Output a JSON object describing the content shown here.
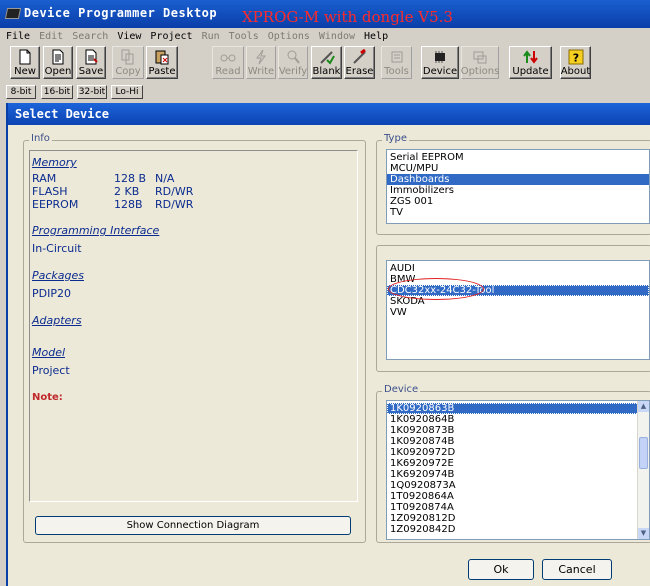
{
  "window": {
    "title": "Device Programmer Desktop"
  },
  "overlay_caption": "XPROG-M with dongle V5.3",
  "menu": [
    {
      "label": "File",
      "enabled": true
    },
    {
      "label": "Edit",
      "enabled": false
    },
    {
      "label": "Search",
      "enabled": false
    },
    {
      "label": "View",
      "enabled": true
    },
    {
      "label": "Project",
      "enabled": true
    },
    {
      "label": "Run",
      "enabled": false
    },
    {
      "label": "Tools",
      "enabled": false
    },
    {
      "label": "Options",
      "enabled": false
    },
    {
      "label": "Window",
      "enabled": false
    },
    {
      "label": "Help",
      "enabled": true
    }
  ],
  "toolbar": {
    "new": "New",
    "open": "Open",
    "save": "Save",
    "copy": "Copy",
    "paste": "Paste",
    "read": "Read",
    "write": "Write",
    "verify": "Verify",
    "blank": "Blank",
    "erase": "Erase",
    "tools": "Tools",
    "device": "Device",
    "options": "Options",
    "update": "Update",
    "about": "About"
  },
  "modes": [
    "8-bit",
    "16-bit",
    "32-bit",
    "Lo-Hi"
  ],
  "dialog": {
    "title": "Select Device",
    "info": {
      "group_label": "Info",
      "memory_heading": "Memory",
      "memory": [
        {
          "name": "RAM",
          "size": "128 B",
          "access": "N/A"
        },
        {
          "name": "FLASH",
          "size": "2 KB",
          "access": "RD/WR"
        },
        {
          "name": "EEPROM",
          "size": "128B",
          "access": "RD/WR"
        }
      ],
      "programming_interface_heading": "Programming Interface",
      "programming_interface": "In-Circuit",
      "packages_heading": "Packages",
      "packages": "PDIP20",
      "adapters_heading": "Adapters",
      "model_heading": "Model",
      "model": "Project",
      "note_label": "Note:"
    },
    "show_diagram_button": "Show Connection Diagram",
    "type": {
      "group_label": "Type",
      "items": [
        "Serial EEPROM",
        "MCU/MPU",
        "Dashboards",
        "Immobilizers",
        "ZGS 001",
        "TV"
      ],
      "selected": "Dashboards"
    },
    "brand": {
      "items": [
        "AUDI",
        "BMW",
        "CDC32xx-24C32-Tool",
        "SKODA",
        "VW"
      ],
      "selected": "CDC32xx-24C32-Tool"
    },
    "device": {
      "group_label": "Device",
      "items": [
        "1K0920863B",
        "1K0920864B",
        "1K0920873B",
        "1K0920874B",
        "1K0920972D",
        "1K6920972E",
        "1K6920974B",
        "1Q0920873A",
        "1T0920864A",
        "1T0920874A",
        "1Z0920812D",
        "1Z0920842D"
      ],
      "selected": "1K0920863B"
    },
    "ok_button": "Ok",
    "cancel_button": "Cancel"
  },
  "colors": {
    "titlebar": "#0a3ea8",
    "selection": "#316ac5",
    "info_text": "#0b2b8f",
    "note": "#c0282a",
    "annotation": "#ff2a2a"
  }
}
